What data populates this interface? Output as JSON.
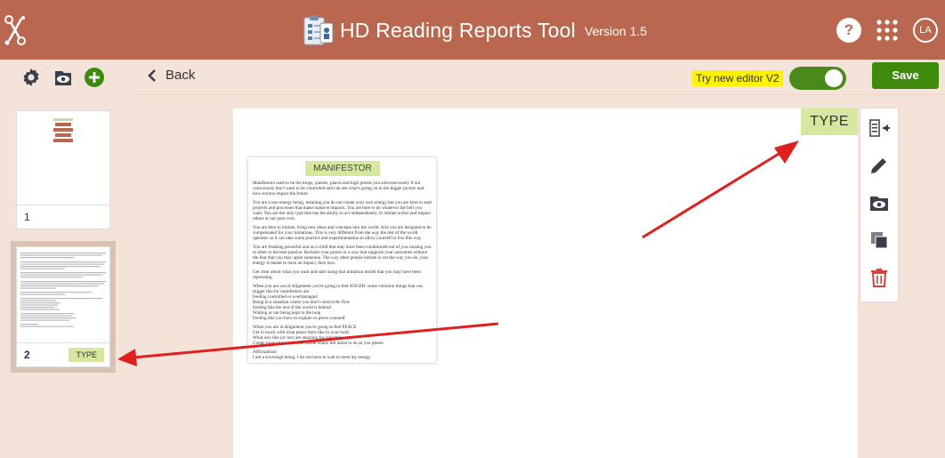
{
  "header": {
    "app_title": "HD Reading Reports Tool",
    "version": "Version 1.5",
    "help_label": "?",
    "avatar_initials": "LA",
    "background_color": "#b9684f"
  },
  "icons": {
    "logo": "tools-logo-icon",
    "title": "clipboard-icon",
    "grid": "apps-grid-icon",
    "settings": "gear-icon",
    "preview": "eye-icon",
    "add": "plus-icon",
    "back": "chevron-left-icon",
    "right_tools": [
      "insert-text-icon",
      "pencil-icon",
      "eye-icon",
      "duplicate-icon",
      "trash-icon"
    ]
  },
  "actions": {
    "back_label": "Back",
    "try_editor_label": "Try new editor V2",
    "toggle_on": true,
    "save_label": "Save"
  },
  "sidebar": {
    "pages": [
      {
        "number": "1",
        "tag": ""
      },
      {
        "number": "2",
        "tag": "TYPE",
        "selected": true
      }
    ]
  },
  "canvas": {
    "type_label": "TYPE",
    "card_title": "MANIFESTOR",
    "paragraphs": [
      "Manifestors used to be the kings, queens, places and high priests you subconsciously if not consciously don't want to be controlled and can see what's going on in the bigger picture and how actions impact the future.",
      "You are a non energy being, meaning you do not create your own energy but you are here to start projects and processes that make massive impacts. You are here to do whatever the hell you want. You are the only type that has the ability to act independently, to initiate action and impact others at our pure core.",
      "You are here to initiate, bring new ideas and concepts into the world. And you are designed to be compensated for your initiations. This is very different from the way the rest of the world operates so it can take some practice and experimentation to allow yourself to live this way.",
      "You are freaking powerful and as a child that may have been conditioned out of you causing you to rebel or become passive. Reclaim your power in a way that supports your outcomes without the fear that you may upset someone. The way other people initiate is not the way you do, your energy is meant to have an impact, then turn.",
      "Get clear about what you want and start using that initiation model that you may have been repressing.",
      "When you are out of Alignment you're going to feel ANGER: some common things that can trigger this for manifestors are:",
      "Feeling controlled or overmanaged",
      "Being in a situation where you don't control the flow",
      "Feeling like the rest of the world is behind",
      "Waiting or not being kept in the loop",
      "Feeling like you have to explain or prove yourself",
      "When you are in Alignment you're going to feel PEACE",
      "Get in touch with what peace feels like in your body",
      "What acts like (or not) are amazing for initiating",
      "Create more space and time inside where left alone to do as you please",
      "Affirmations",
      "I am a sovereign being. I do not have to wait to meet my energy"
    ]
  }
}
